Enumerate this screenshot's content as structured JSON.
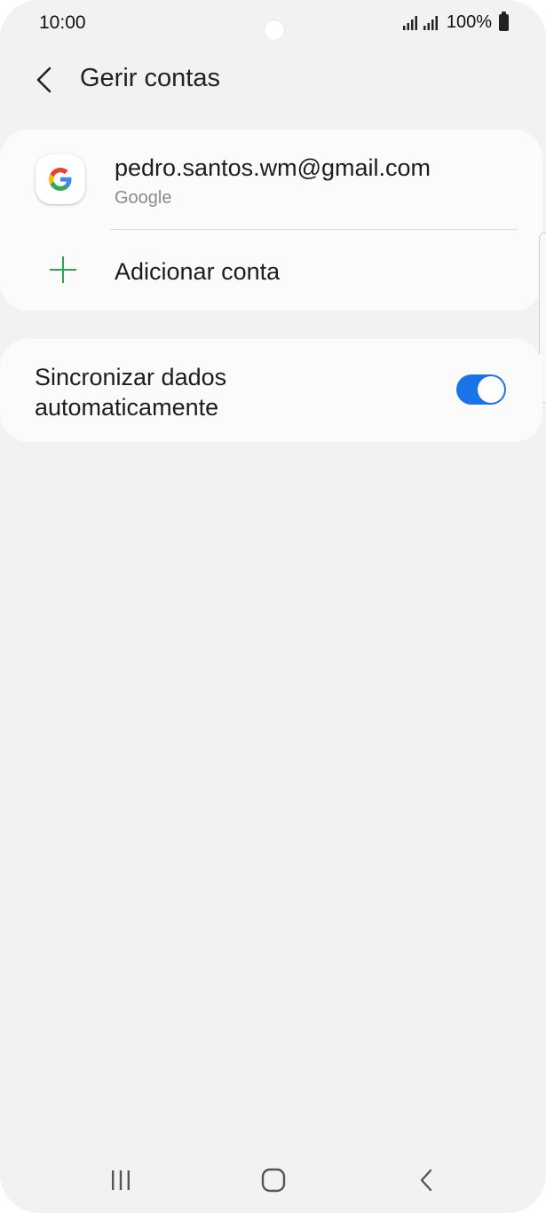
{
  "status_bar": {
    "time": "10:00",
    "battery": "100%"
  },
  "header": {
    "title": "Gerir contas"
  },
  "accounts": {
    "email": "pedro.santos.wm@gmail.com",
    "type": "Google",
    "add_label": "Adicionar conta"
  },
  "sync": {
    "label": "Sincronizar dados automaticamente",
    "enabled": true
  },
  "colors": {
    "accent": "#1a73e8",
    "plus": "#2aa84a",
    "background": "#f2f2f2",
    "card": "#fbfbfb"
  },
  "icons": {
    "back": "chevron-left-icon",
    "google": "google-logo-icon",
    "add": "plus-icon",
    "nav_recent": "recent-apps-icon",
    "nav_home": "home-icon",
    "nav_back": "back-icon"
  }
}
